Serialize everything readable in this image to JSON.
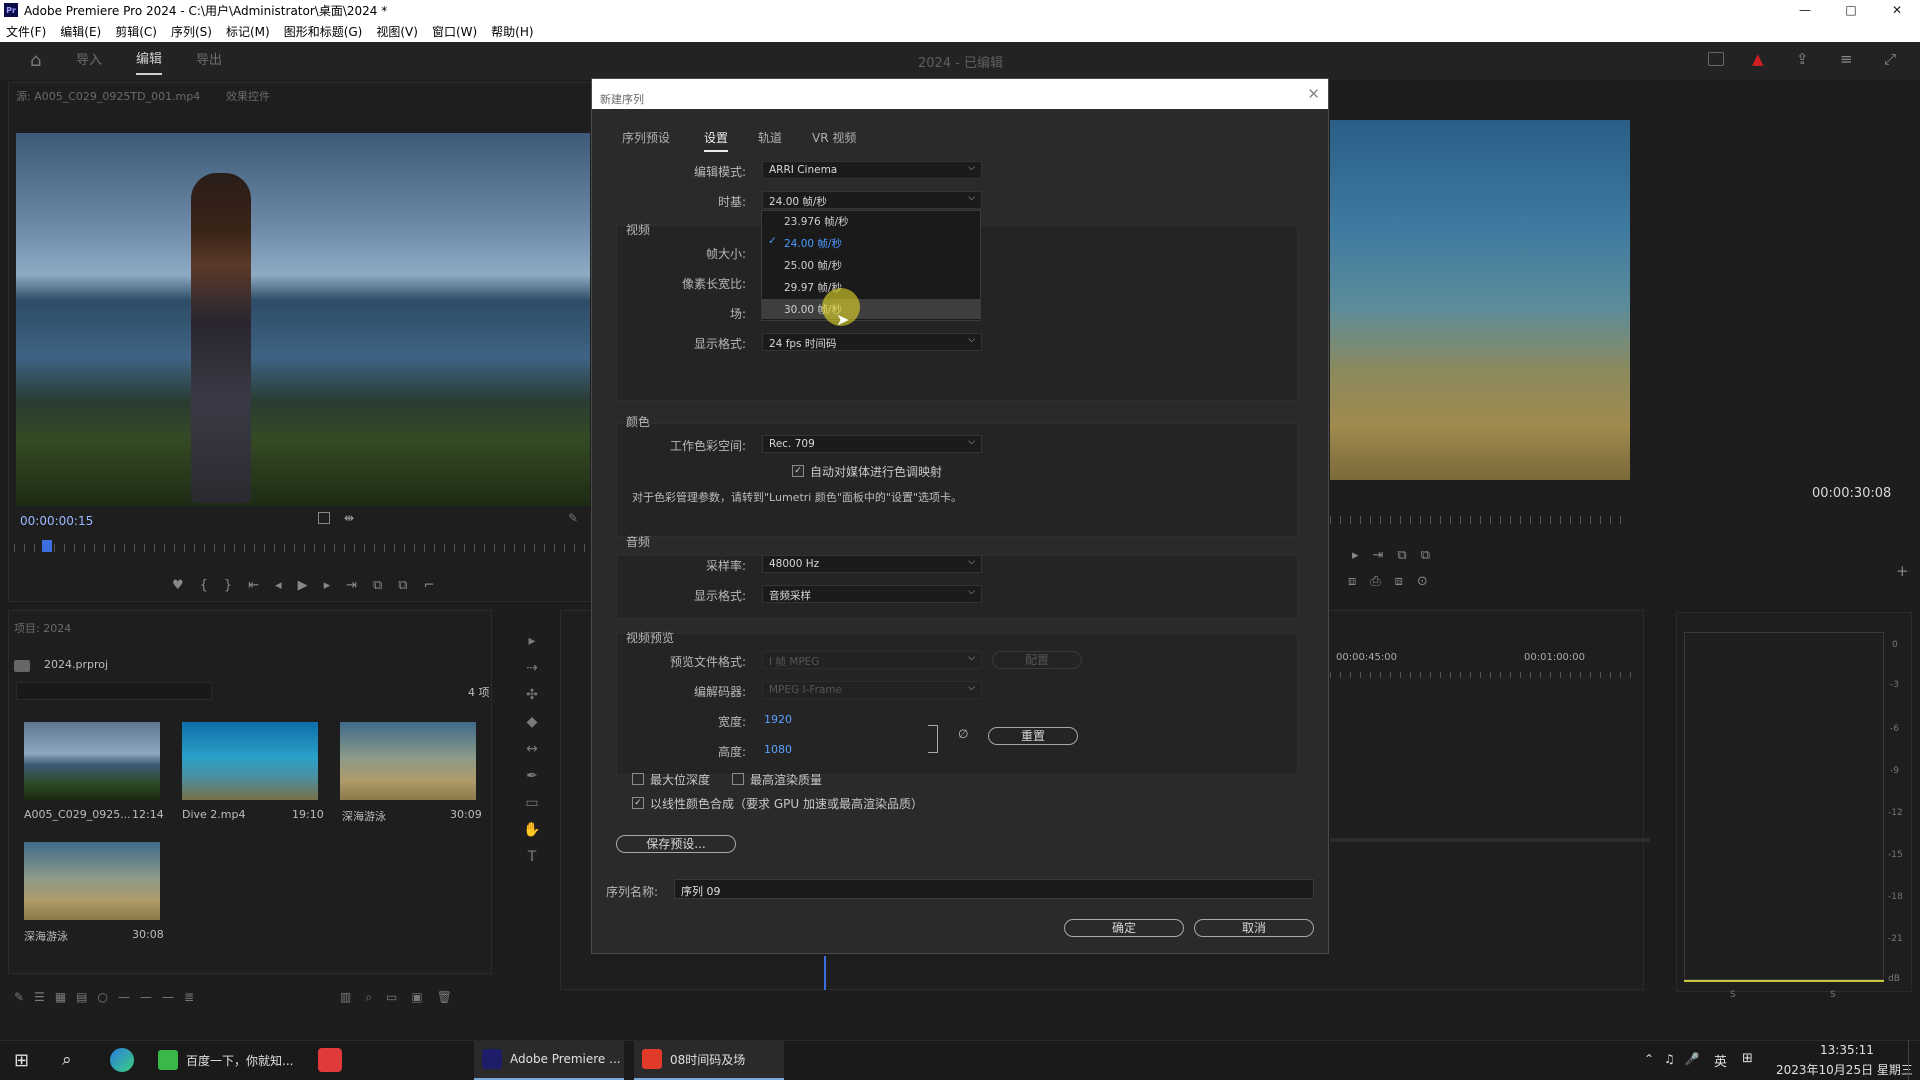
{
  "window": {
    "title": "Adobe Premiere Pro 2024 - C:\\用户\\Administrator\\桌面\\2024 *",
    "controls": [
      "—",
      "□",
      "✕"
    ]
  },
  "menu": [
    "文件(F)",
    "编辑(E)",
    "剪辑(C)",
    "序列(S)",
    "标记(M)",
    "图形和标题(G)",
    "视图(V)",
    "窗口(W)",
    "帮助(H)"
  ],
  "header": {
    "tabs": [
      "导入",
      "编辑",
      "导出"
    ],
    "active_tab": "编辑",
    "project_title": "2024 - 已编辑"
  },
  "source_monitor": {
    "tab": "源: A005_C029_0925TD_001.mp4",
    "tab2": "效果控件",
    "timecode": "00:00:00:15"
  },
  "program_monitor": {
    "timecode": "00:00:30:08"
  },
  "project_panel": {
    "title": "项目: 2024",
    "file": "2024.prproj",
    "count": "4 项",
    "items": [
      {
        "name": "A005_C029_0925...",
        "duration": "12:14"
      },
      {
        "name": "Dive 2.mp4",
        "duration": "19:10"
      },
      {
        "name": "深海游泳",
        "duration": "30:09"
      },
      {
        "name": "深海游泳",
        "duration": "30:08"
      }
    ]
  },
  "timeline": {
    "ruler": [
      "00:00:45:00",
      "00:01:00:00"
    ]
  },
  "audio_meter": {
    "scale": [
      "0",
      "-3",
      "-6",
      "-9",
      "-12",
      "-15",
      "-18",
      "-21",
      "dB"
    ],
    "bottom": [
      "S",
      "S"
    ]
  },
  "dialog": {
    "title": "新建序列",
    "tabs": [
      "序列预设",
      "设置",
      "轨道",
      "VR 视频"
    ],
    "active_tab": "设置",
    "edit_mode_label": "编辑模式:",
    "edit_mode": "ARRI Cinema",
    "timebase_label": "时基:",
    "timebase": "24.00 帧/秒",
    "video_section": "视频",
    "frame_size_label": "帧大小:",
    "pixel_aspect_label": "像素长宽比:",
    "fields_label": "场:",
    "display_format_label": "显示格式:",
    "display_format": "24 fps 时间码",
    "color_section": "颜色",
    "working_color_label": "工作色彩空间:",
    "working_color": "Rec. 709",
    "auto_tone_map": "自动对媒体进行色调映射",
    "color_note": "对于色彩管理参数，请转到\"Lumetri 颜色\"面板中的\"设置\"选项卡。",
    "audio_section": "音频",
    "sample_rate_label": "采样率:",
    "sample_rate": "48000 Hz",
    "audio_display_label": "显示格式:",
    "audio_display": "音频采样",
    "preview_section": "视频预览",
    "preview_format_label": "预览文件格式:",
    "preview_format": "I 帧 MPEG",
    "configure": "配置",
    "codec_label": "编解码器:",
    "codec": "MPEG I-Frame",
    "width_label": "宽度:",
    "width": "1920",
    "height_label": "高度:",
    "height": "1080",
    "reset": "重置",
    "max_bit_depth": "最大位深度",
    "max_render_quality": "最高渲染质量",
    "linear_color": "以线性颜色合成（要求 GPU 加速或最高渲染品质）",
    "save_preset": "保存预设...",
    "seq_name_label": "序列名称:",
    "seq_name": "序列 09",
    "ok": "确定",
    "cancel": "取消",
    "timebase_options": [
      {
        "num": "23.976",
        "unit": "帧/秒"
      },
      {
        "num": "24.00",
        "unit": "帧/秒"
      },
      {
        "num": "25.00",
        "unit": "帧/秒"
      },
      {
        "num": "29.97",
        "unit": "帧/秒"
      },
      {
        "num": "30.00",
        "unit": "帧/秒"
      }
    ]
  },
  "taskbar": {
    "items": [
      "百度一下，你就知...",
      "Adobe Premiere ...",
      "08时间码及场"
    ],
    "tray_lang": "英",
    "time": "13:35:11",
    "date": "2023年10月25日 星期三"
  }
}
